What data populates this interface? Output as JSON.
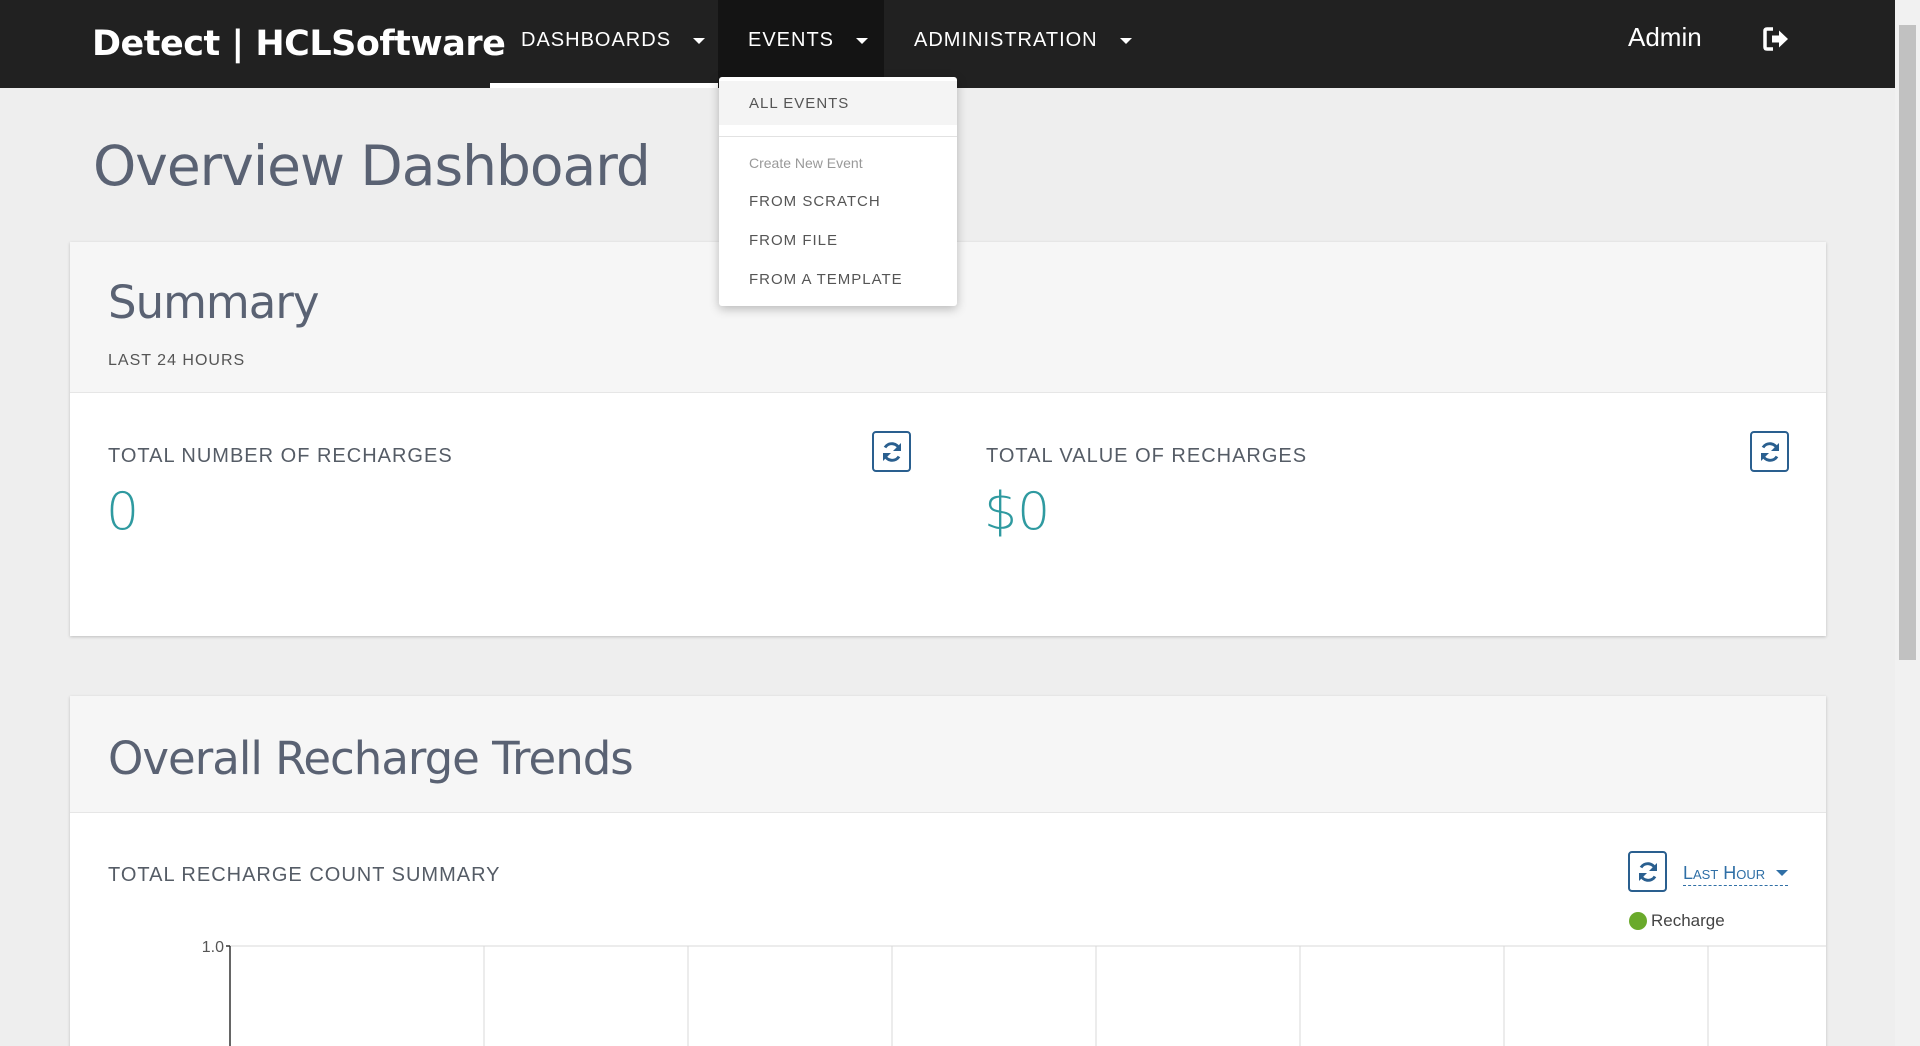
{
  "brand": "Detect | HCLSoftware",
  "nav": {
    "items": [
      {
        "label": "DASHBOARDS"
      },
      {
        "label": "EVENTS"
      },
      {
        "label": "ADMINISTRATION"
      }
    ],
    "user": "Admin",
    "logout_icon": "sign-out-icon"
  },
  "events_menu": {
    "all_events": "ALL EVENTS",
    "header": "Create New Event",
    "from_scratch": "FROM SCRATCH",
    "from_file": "FROM FILE",
    "from_template": "FROM A TEMPLATE"
  },
  "page": {
    "title": "Overview Dashboard"
  },
  "summary": {
    "title": "Summary",
    "subtitle": "LAST 24 HOURS",
    "metrics": [
      {
        "label": "TOTAL NUMBER OF RECHARGES",
        "value": "0"
      },
      {
        "label": "TOTAL VALUE OF RECHARGES",
        "value": "$0"
      }
    ]
  },
  "trends": {
    "title": "Overall Recharge Trends",
    "subtitle": "TOTAL RECHARGE COUNT SUMMARY",
    "range": "Last Hour",
    "legend": "Recharge"
  },
  "colors": {
    "accent": "#2f9aa0",
    "link": "#2f6fa6",
    "legend_dot": "#6aaa2b",
    "navbar": "#212121"
  },
  "chart_data": {
    "type": "line",
    "series": [
      {
        "name": "Recharge",
        "values": []
      }
    ],
    "y_ticks": [
      "1.0"
    ],
    "ylim_top": 1.0,
    "legend": "top-right",
    "grid": true
  }
}
